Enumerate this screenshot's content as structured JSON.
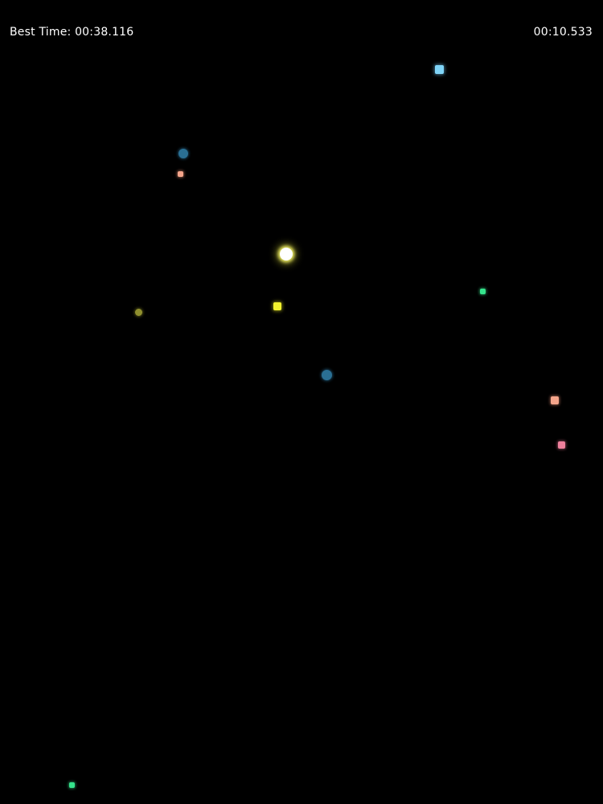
{
  "hud": {
    "best_time_label": "Best Time: 00:38.116",
    "current_time": "00:10.533"
  },
  "player": {
    "color": "#ffffff",
    "glow": "#f7f66a",
    "icon": "glowing-orb-icon"
  },
  "entities": [
    {
      "id": "e1",
      "shape": "square",
      "color": "#7fd4f7"
    },
    {
      "id": "e2",
      "shape": "circle",
      "color": "#2a6f93"
    },
    {
      "id": "e3",
      "shape": "square",
      "color": "#f4a48a"
    },
    {
      "id": "e4",
      "shape": "square",
      "color": "#35e38c"
    },
    {
      "id": "e5",
      "shape": "circle",
      "color": "#8f8f2e"
    },
    {
      "id": "e6",
      "shape": "square",
      "color": "#f2f22e"
    },
    {
      "id": "e7",
      "shape": "circle",
      "color": "#2a6f93"
    },
    {
      "id": "e8",
      "shape": "square",
      "color": "#f4a48a"
    },
    {
      "id": "e9",
      "shape": "square",
      "color": "#ee7f9b"
    },
    {
      "id": "e10",
      "shape": "square",
      "color": "#35e38c"
    }
  ]
}
